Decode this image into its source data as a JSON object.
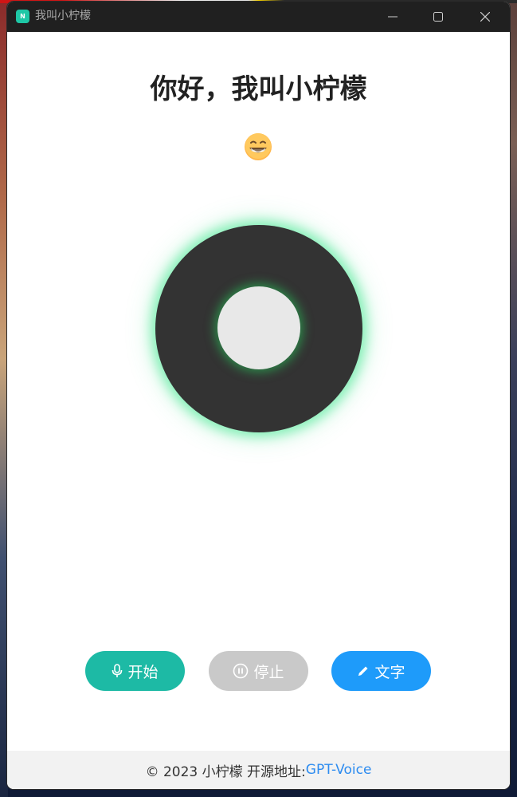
{
  "window": {
    "title": "我叫小柠檬",
    "icon_text": "N",
    "controls": [
      "minimize-icon",
      "maximize-icon",
      "close-icon"
    ]
  },
  "main": {
    "heading": "你好，我叫小柠檬",
    "emoji": "grinning-face-emoji"
  },
  "buttons": {
    "start_label": "开始",
    "start_icon": "microphone-icon",
    "stop_label": "停止",
    "stop_icon": "pause-circle-icon",
    "text_label": "文字",
    "text_icon": "pencil-icon"
  },
  "footer": {
    "prefix": "© 2023 小柠檬 开源地址:",
    "link_text": "GPT-Voice"
  },
  "colors": {
    "titlebar": "#202020",
    "start": "#1dbaa5",
    "stop": "#c9c9c9",
    "text": "#1e9bfa",
    "link": "#2d8cf0",
    "orb": "#333333",
    "glow": "#3ce68c"
  }
}
